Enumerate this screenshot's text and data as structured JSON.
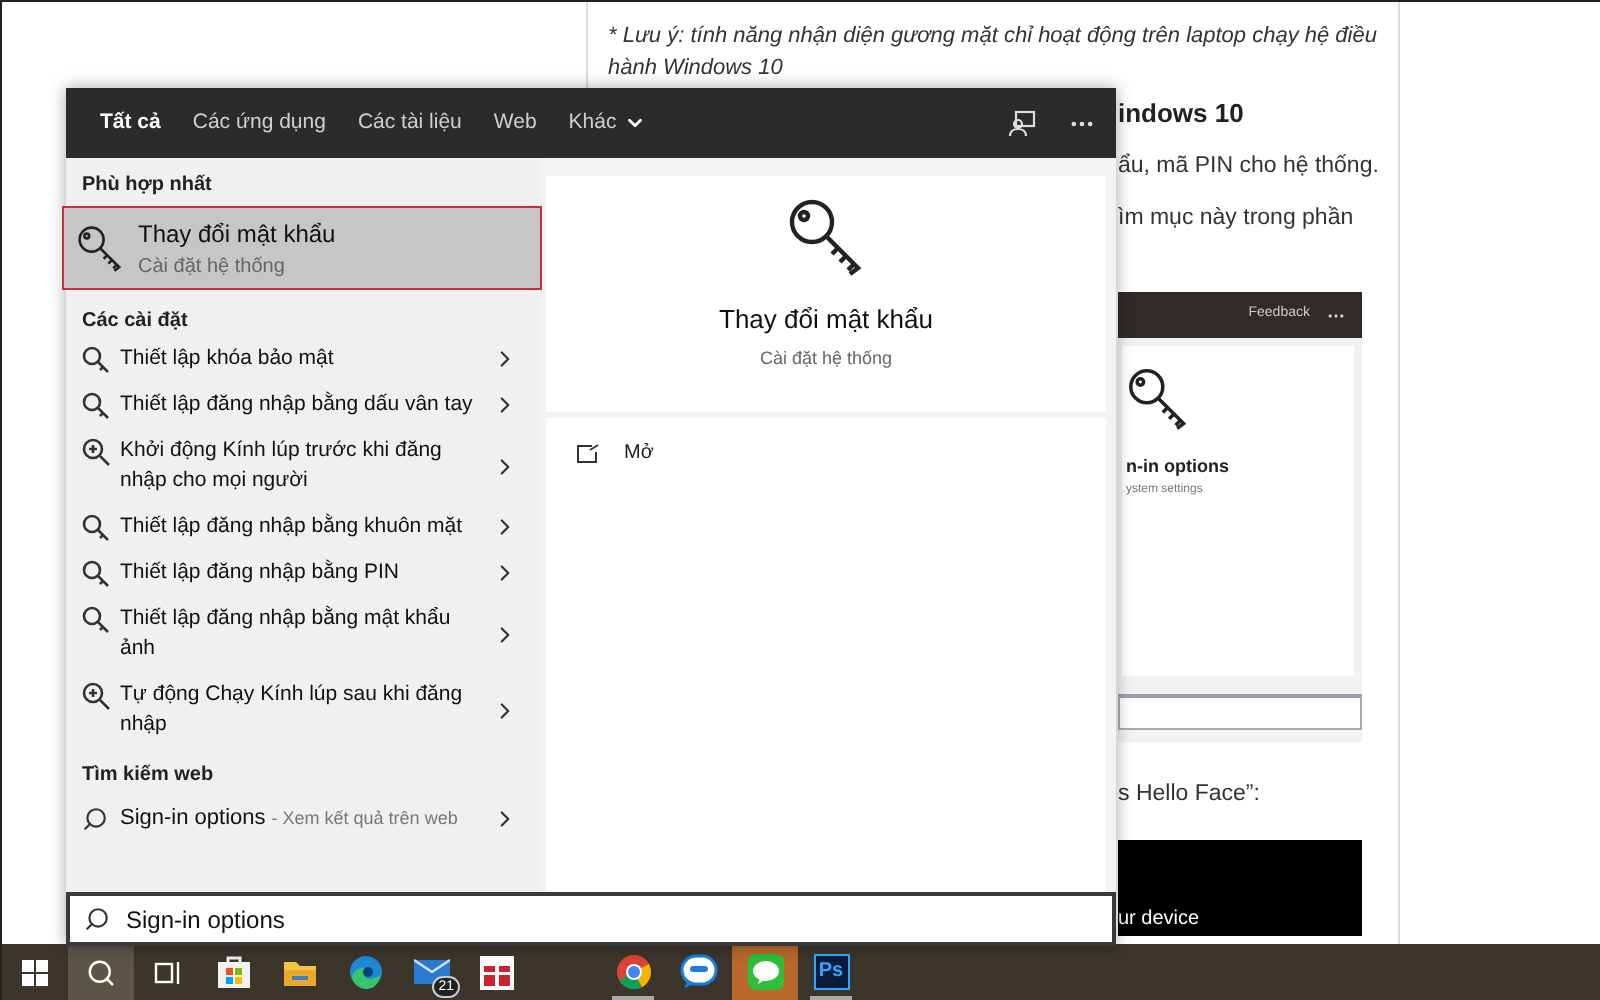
{
  "article": {
    "note_lines": [
      "* Lưu ý: tính năng nhận diện gương mặt chỉ hoạt động trên laptop chạy hệ điều",
      "hành Windows 10"
    ],
    "heading": "indows 10",
    "lines": [
      "ẩu, mã PIN cho hệ thống.",
      "ìm mục này trong phần"
    ],
    "embedded": {
      "link": "Feedback",
      "title": "n-in options",
      "subtitle": "ystem settings"
    },
    "quote": "s Hello Face”:",
    "video_caption": "ur device"
  },
  "search_panel": {
    "tabs": [
      {
        "label": "Tất cả",
        "selected": true,
        "has_menu": false
      },
      {
        "label": "Các ứng dụng",
        "selected": false,
        "has_menu": false
      },
      {
        "label": "Các tài liệu",
        "selected": false,
        "has_menu": false
      },
      {
        "label": "Web",
        "selected": false,
        "has_menu": false
      },
      {
        "label": "Khác",
        "selected": false,
        "has_menu": true
      }
    ],
    "best_match": {
      "heading": "Phù hợp nhất",
      "title": "Thay đổi mật khẩu",
      "subtitle": "Cài đặt hệ thống",
      "selected": true
    },
    "settings": {
      "heading": "Các cài đặt",
      "items": [
        {
          "label": "Thiết lập khóa bảo mật",
          "kind": "setting"
        },
        {
          "label": "Thiết lập đăng nhập bằng dấu vân tay",
          "kind": "setting"
        },
        {
          "label": "Khởi động Kính lúp trước khi đăng nhập cho mọi người",
          "kind": "magnifier"
        },
        {
          "label": "Thiết lập đăng nhập bằng khuôn mặt",
          "kind": "setting"
        },
        {
          "label": "Thiết lập đăng nhập bằng PIN",
          "kind": "setting"
        },
        {
          "label": "Thiết lập đăng nhập bằng mật khẩu ảnh",
          "kind": "setting"
        },
        {
          "label": "Tự động Chạy Kính lúp sau khi đăng nhập",
          "kind": "magnifier"
        }
      ]
    },
    "web": {
      "heading": "Tìm kiếm web",
      "items": [
        {
          "label": "Sign-in options",
          "hint": "- Xem kết quả trên web"
        }
      ]
    },
    "preview": {
      "title": "Thay đổi mật khẩu",
      "subtitle": "Cài đặt hệ thống",
      "actions": [
        {
          "label": "Mở"
        }
      ]
    },
    "search_field": {
      "value": "Sign-in options"
    }
  },
  "taskbar": {
    "groups": [
      {
        "apps": [
          {
            "kind": "start",
            "selected": false
          },
          {
            "kind": "search",
            "selected": true
          },
          {
            "kind": "taskview",
            "selected": false
          },
          {
            "kind": "store",
            "selected": false
          },
          {
            "kind": "folder",
            "selected": false
          },
          {
            "kind": "edge",
            "selected": false
          },
          {
            "kind": "mail",
            "selected": false,
            "badge": "21"
          },
          {
            "kind": "gift",
            "selected": false
          }
        ]
      },
      {
        "apps": [
          {
            "kind": "chrome",
            "selected": false,
            "running": true
          },
          {
            "kind": "chat",
            "selected": false
          },
          {
            "kind": "line",
            "selected": false,
            "attention": true
          },
          {
            "kind": "ps",
            "selected": false,
            "running": true,
            "label": "Ps"
          }
        ]
      }
    ]
  }
}
